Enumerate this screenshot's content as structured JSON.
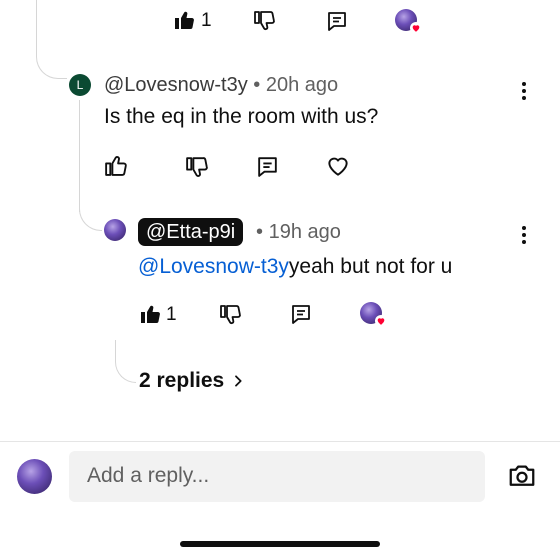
{
  "top_action_bar": {
    "like_count": "1"
  },
  "comment": {
    "avatar_letter": "L",
    "author": "@Lovesnow-t3y",
    "separator": "•",
    "timestamp": "20h ago",
    "text": "Is the eq in the room with us?"
  },
  "reply": {
    "author": "@Etta-p9i",
    "separator": "•",
    "timestamp": "19h ago",
    "mention": "@Lovesnow-t3y",
    "text": "yeah but not for u",
    "like_count": "1"
  },
  "replies_link": {
    "label": "2 replies"
  },
  "compose": {
    "placeholder": "Add a reply..."
  },
  "colors": {
    "mention": "#065fd4",
    "heart": "#ff0033",
    "chip_bg": "#0f0f0f",
    "avatar_green": "#0b4a32"
  }
}
